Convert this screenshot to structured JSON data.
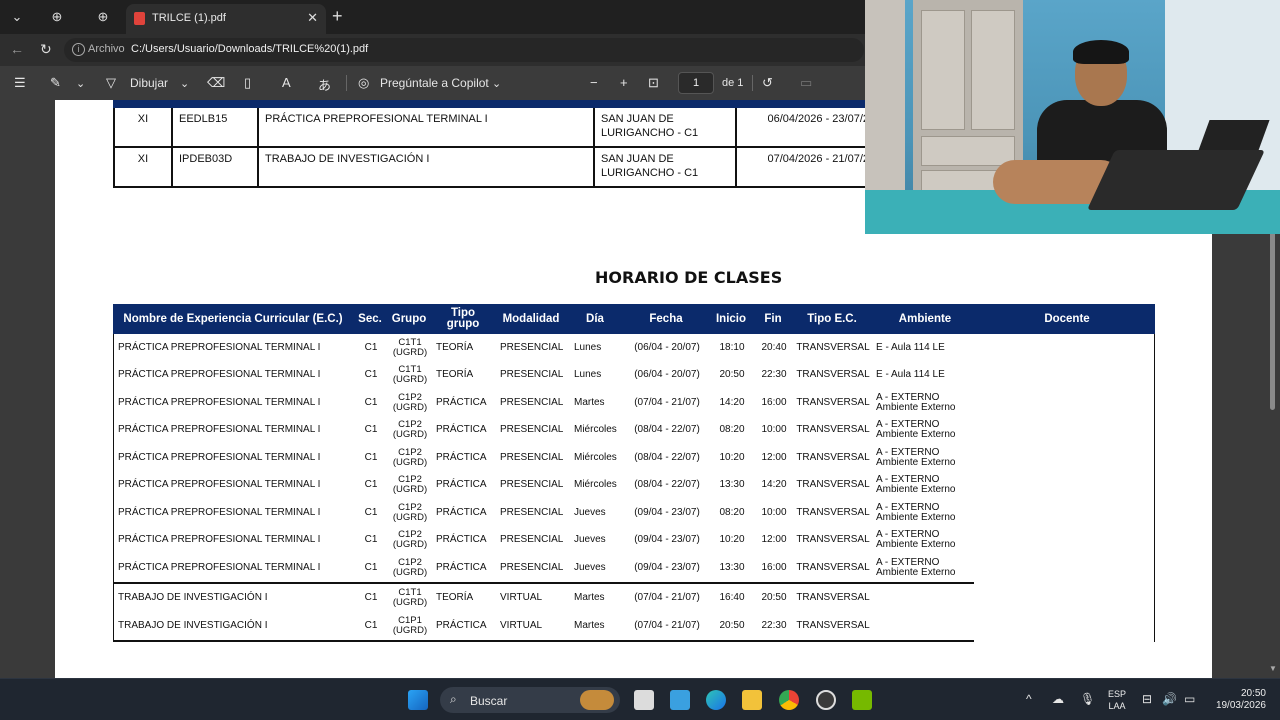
{
  "browser": {
    "tab_title": "TRILCE (1).pdf",
    "tab_close": "✕",
    "new_tab": "+",
    "scheme_label": "Archivo",
    "url": "C:/Users/Usuario/Downloads/TRILCE%20(1).pdf"
  },
  "pdf_toolbar": {
    "draw_label": "Dibujar",
    "copilot_label": "Pregúntale a Copilot",
    "page_number": "1",
    "page_total": "de 1",
    "zoom_out": "−",
    "zoom_in": "+"
  },
  "top_table": {
    "rows": [
      {
        "cycle": "XI",
        "code": "EEDLB15",
        "course": "PRÁCTICA PREPROFESIONAL TERMINAL I",
        "campus": "SAN JUAN DE LURIGANCHO - C1",
        "dates": "06/04/2026 - 23/07/2"
      },
      {
        "cycle": "XI",
        "code": "IPDEB03D",
        "course": "TRABAJO DE INVESTIGACIÓN I",
        "campus": "SAN JUAN DE LURIGANCHO - C1",
        "dates": "07/04/2026 - 21/07/2"
      }
    ]
  },
  "schedule": {
    "title": "HORARIO DE CLASES",
    "headers": [
      "Nombre de Experiencia Curricular (E.C.)",
      "Sec.",
      "Grupo",
      "Tipo grupo",
      "Modalidad",
      "Día",
      "Fecha",
      "Inicio",
      "Fin",
      "Tipo E.C.",
      "Ambiente",
      "Docente"
    ],
    "rows": [
      {
        "name": "PRÁCTICA PREPROFESIONAL TERMINAL I",
        "sec": "C1",
        "grupo": "C1T1 (UGRD)",
        "tipo": "TEORÍA",
        "modalidad": "PRESENCIAL",
        "dia": "Lunes",
        "fecha": "(06/04 - 20/07)",
        "inicio": "18:10",
        "fin": "20:40",
        "tipo_ec": "TRANSVERSAL",
        "ambiente": "E - Aula 114 LE"
      },
      {
        "name": "PRÁCTICA PREPROFESIONAL TERMINAL I",
        "sec": "C1",
        "grupo": "C1T1 (UGRD)",
        "tipo": "TEORÍA",
        "modalidad": "PRESENCIAL",
        "dia": "Lunes",
        "fecha": "(06/04 - 20/07)",
        "inicio": "20:50",
        "fin": "22:30",
        "tipo_ec": "TRANSVERSAL",
        "ambiente": "E - Aula 114 LE"
      },
      {
        "name": "PRÁCTICA PREPROFESIONAL TERMINAL I",
        "sec": "C1",
        "grupo": "C1P2 (UGRD)",
        "tipo": "PRÁCTICA",
        "modalidad": "PRESENCIAL",
        "dia": "Martes",
        "fecha": "(07/04 - 21/07)",
        "inicio": "14:20",
        "fin": "16:00",
        "tipo_ec": "TRANSVERSAL",
        "ambiente": "A - EXTERNO Ambiente Externo"
      },
      {
        "name": "PRÁCTICA PREPROFESIONAL TERMINAL I",
        "sec": "C1",
        "grupo": "C1P2 (UGRD)",
        "tipo": "PRÁCTICA",
        "modalidad": "PRESENCIAL",
        "dia": "Miércoles",
        "fecha": "(08/04 - 22/07)",
        "inicio": "08:20",
        "fin": "10:00",
        "tipo_ec": "TRANSVERSAL",
        "ambiente": "A - EXTERNO Ambiente Externo"
      },
      {
        "name": "PRÁCTICA PREPROFESIONAL TERMINAL I",
        "sec": "C1",
        "grupo": "C1P2 (UGRD)",
        "tipo": "PRÁCTICA",
        "modalidad": "PRESENCIAL",
        "dia": "Miércoles",
        "fecha": "(08/04 - 22/07)",
        "inicio": "10:20",
        "fin": "12:00",
        "tipo_ec": "TRANSVERSAL",
        "ambiente": "A - EXTERNO Ambiente Externo"
      },
      {
        "name": "PRÁCTICA PREPROFESIONAL TERMINAL I",
        "sec": "C1",
        "grupo": "C1P2 (UGRD)",
        "tipo": "PRÁCTICA",
        "modalidad": "PRESENCIAL",
        "dia": "Miércoles",
        "fecha": "(08/04 - 22/07)",
        "inicio": "13:30",
        "fin": "14:20",
        "tipo_ec": "TRANSVERSAL",
        "ambiente": "A - EXTERNO Ambiente Externo"
      },
      {
        "name": "PRÁCTICA PREPROFESIONAL TERMINAL I",
        "sec": "C1",
        "grupo": "C1P2 (UGRD)",
        "tipo": "PRÁCTICA",
        "modalidad": "PRESENCIAL",
        "dia": "Jueves",
        "fecha": "(09/04 - 23/07)",
        "inicio": "08:20",
        "fin": "10:00",
        "tipo_ec": "TRANSVERSAL",
        "ambiente": "A - EXTERNO Ambiente Externo"
      },
      {
        "name": "PRÁCTICA PREPROFESIONAL TERMINAL I",
        "sec": "C1",
        "grupo": "C1P2 (UGRD)",
        "tipo": "PRÁCTICA",
        "modalidad": "PRESENCIAL",
        "dia": "Jueves",
        "fecha": "(09/04 - 23/07)",
        "inicio": "10:20",
        "fin": "12:00",
        "tipo_ec": "TRANSVERSAL",
        "ambiente": "A - EXTERNO Ambiente Externo"
      },
      {
        "name": "PRÁCTICA PREPROFESIONAL TERMINAL I",
        "sec": "C1",
        "grupo": "C1P2 (UGRD)",
        "tipo": "PRÁCTICA",
        "modalidad": "PRESENCIAL",
        "dia": "Jueves",
        "fecha": "(09/04 - 23/07)",
        "inicio": "13:30",
        "fin": "16:00",
        "tipo_ec": "TRANSVERSAL",
        "ambiente": "A - EXTERNO Ambiente Externo"
      },
      {
        "name": "TRABAJO DE INVESTIGACIÓN I",
        "sec": "C1",
        "grupo": "C1T1 (UGRD)",
        "tipo": "TEORÍA",
        "modalidad": "VIRTUAL",
        "dia": "Martes",
        "fecha": "(07/04 - 21/07)",
        "inicio": "16:40",
        "fin": "20:50",
        "tipo_ec": "TRANSVERSAL",
        "ambiente": ""
      },
      {
        "name": "TRABAJO DE INVESTIGACIÓN I",
        "sec": "C1",
        "grupo": "C1P1 (UGRD)",
        "tipo": "PRÁCTICA",
        "modalidad": "VIRTUAL",
        "dia": "Martes",
        "fecha": "(07/04 - 21/07)",
        "inicio": "20:50",
        "fin": "22:30",
        "tipo_ec": "TRANSVERSAL",
        "ambiente": ""
      }
    ]
  },
  "taskbar": {
    "search_placeholder": "Buscar",
    "lang_line1": "ESP",
    "lang_line2": "LAA",
    "time": "20:50",
    "date": "19/03/2026"
  },
  "colors": {
    "table_header": "#0b2a6b",
    "pdf_toolbar": "#3b3b3b",
    "taskbar": "#1f2630"
  }
}
